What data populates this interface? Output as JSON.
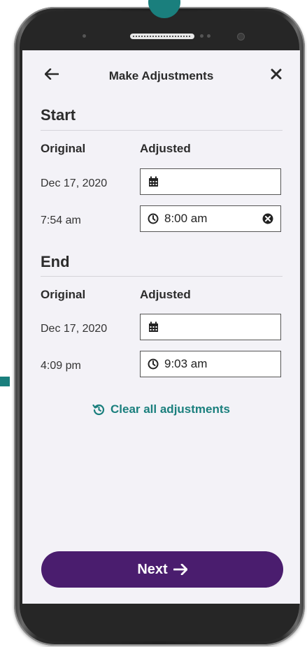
{
  "header": {
    "title": "Make Adjustments",
    "back_icon": "arrow-left-icon",
    "close_icon": "close-icon"
  },
  "start": {
    "section_title": "Start",
    "original_header": "Original",
    "adjusted_header": "Adjusted",
    "original_date": "Dec 17, 2020",
    "adjusted_date": "",
    "original_time": "7:54  am",
    "adjusted_time": "8:00 am"
  },
  "end": {
    "section_title": "End",
    "original_header": "Original",
    "adjusted_header": "Adjusted",
    "original_date": "Dec 17, 2020",
    "adjusted_date": "",
    "original_time": "4:09 pm",
    "adjusted_time": "9:03 am"
  },
  "actions": {
    "clear_all_label": "Clear all adjustments",
    "next_label": "Next"
  },
  "colors": {
    "accent_teal": "#1a7f7d",
    "primary_purple": "#4a1d6e",
    "screen_bg": "#f3f2f7"
  }
}
